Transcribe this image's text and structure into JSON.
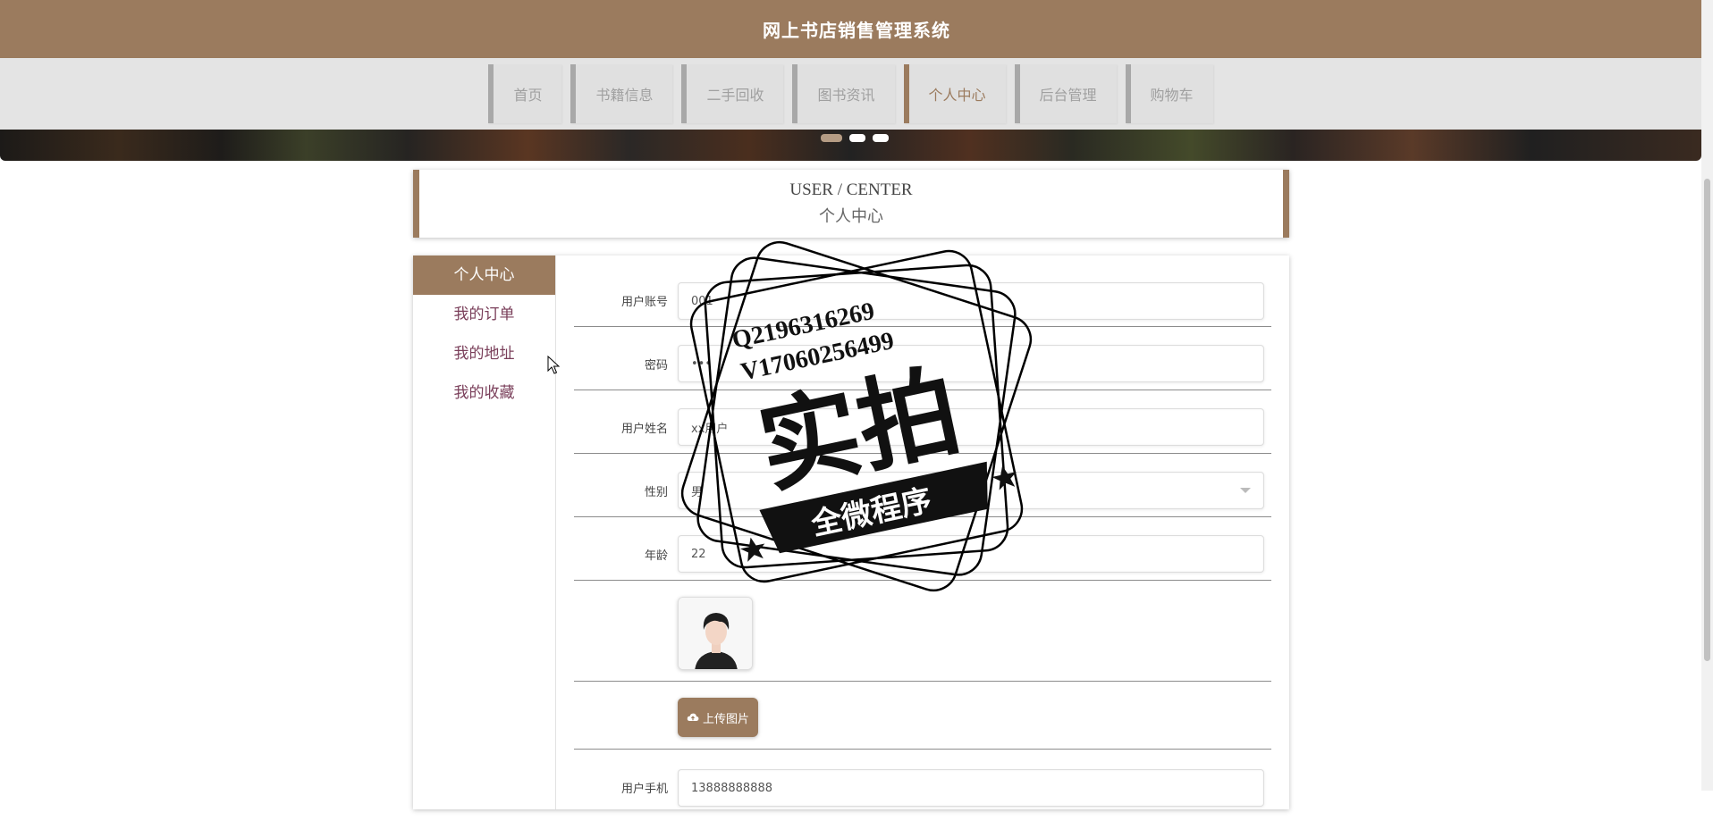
{
  "site": {
    "title": "网上书店销售管理系统"
  },
  "nav": {
    "items": [
      {
        "label": "首页",
        "active": false
      },
      {
        "label": "书籍信息",
        "active": false
      },
      {
        "label": "二手回收",
        "active": false
      },
      {
        "label": "图书资讯",
        "active": false
      },
      {
        "label": "个人中心",
        "active": true
      },
      {
        "label": "后台管理",
        "active": false
      },
      {
        "label": "购物车",
        "active": false
      }
    ]
  },
  "section": {
    "title_en": "USER / CENTER",
    "title_cn": "个人中心"
  },
  "sidebar": {
    "items": [
      {
        "label": "个人中心",
        "active": true
      },
      {
        "label": "我的订单",
        "active": false
      },
      {
        "label": "我的地址",
        "active": false
      },
      {
        "label": "我的收藏",
        "active": false
      }
    ]
  },
  "form": {
    "account_label": "用户账号",
    "account_value": "001",
    "password_label": "密码",
    "password_value": "•••",
    "name_label": "用户姓名",
    "name_value": "xx用户",
    "gender_label": "性别",
    "gender_value": "男",
    "age_label": "年龄",
    "age_value": "22",
    "upload_label": "上传图片",
    "phone_label": "用户手机",
    "phone_value": "13888888888"
  },
  "watermark": {
    "line1": "Q2196316269",
    "line2": "V17060256499",
    "main": "实拍",
    "ribbon": "全微程序"
  },
  "colors": {
    "brand": "#9b7b5e",
    "nav_bg": "#e4e4e4"
  },
  "icons": {
    "upload": "cloud-upload-icon",
    "avatar": "avatar-image",
    "cursor": "mouse-cursor-icon"
  }
}
